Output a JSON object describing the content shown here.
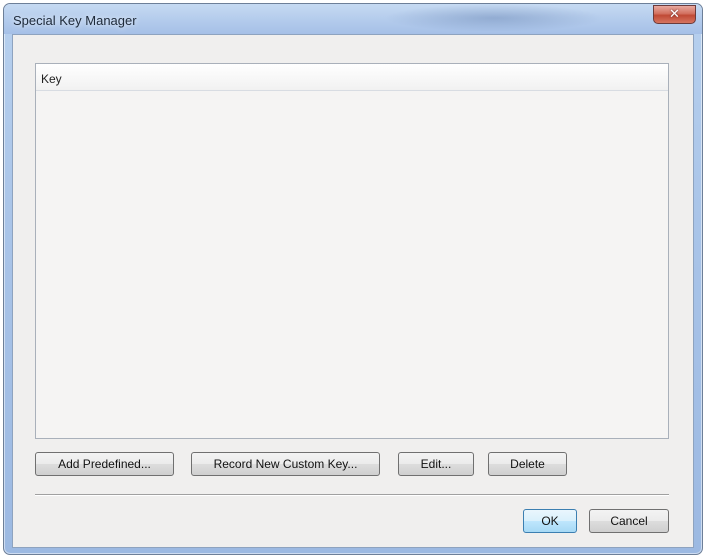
{
  "window": {
    "title": "Special Key Manager",
    "close_icon": "close-icon"
  },
  "listview": {
    "columns": [
      "Key"
    ],
    "rows": []
  },
  "buttons": {
    "add_predefined": "Add Predefined...",
    "record_new_custom_key": "Record New Custom Key...",
    "edit": "Edit...",
    "delete": "Delete",
    "ok": "OK",
    "cancel": "Cancel"
  },
  "colors": {
    "titlebar": "#b3cbec",
    "close_button": "#c04a36",
    "default_button_border": "#3c7fb1",
    "dialog_background": "#f0efee"
  }
}
